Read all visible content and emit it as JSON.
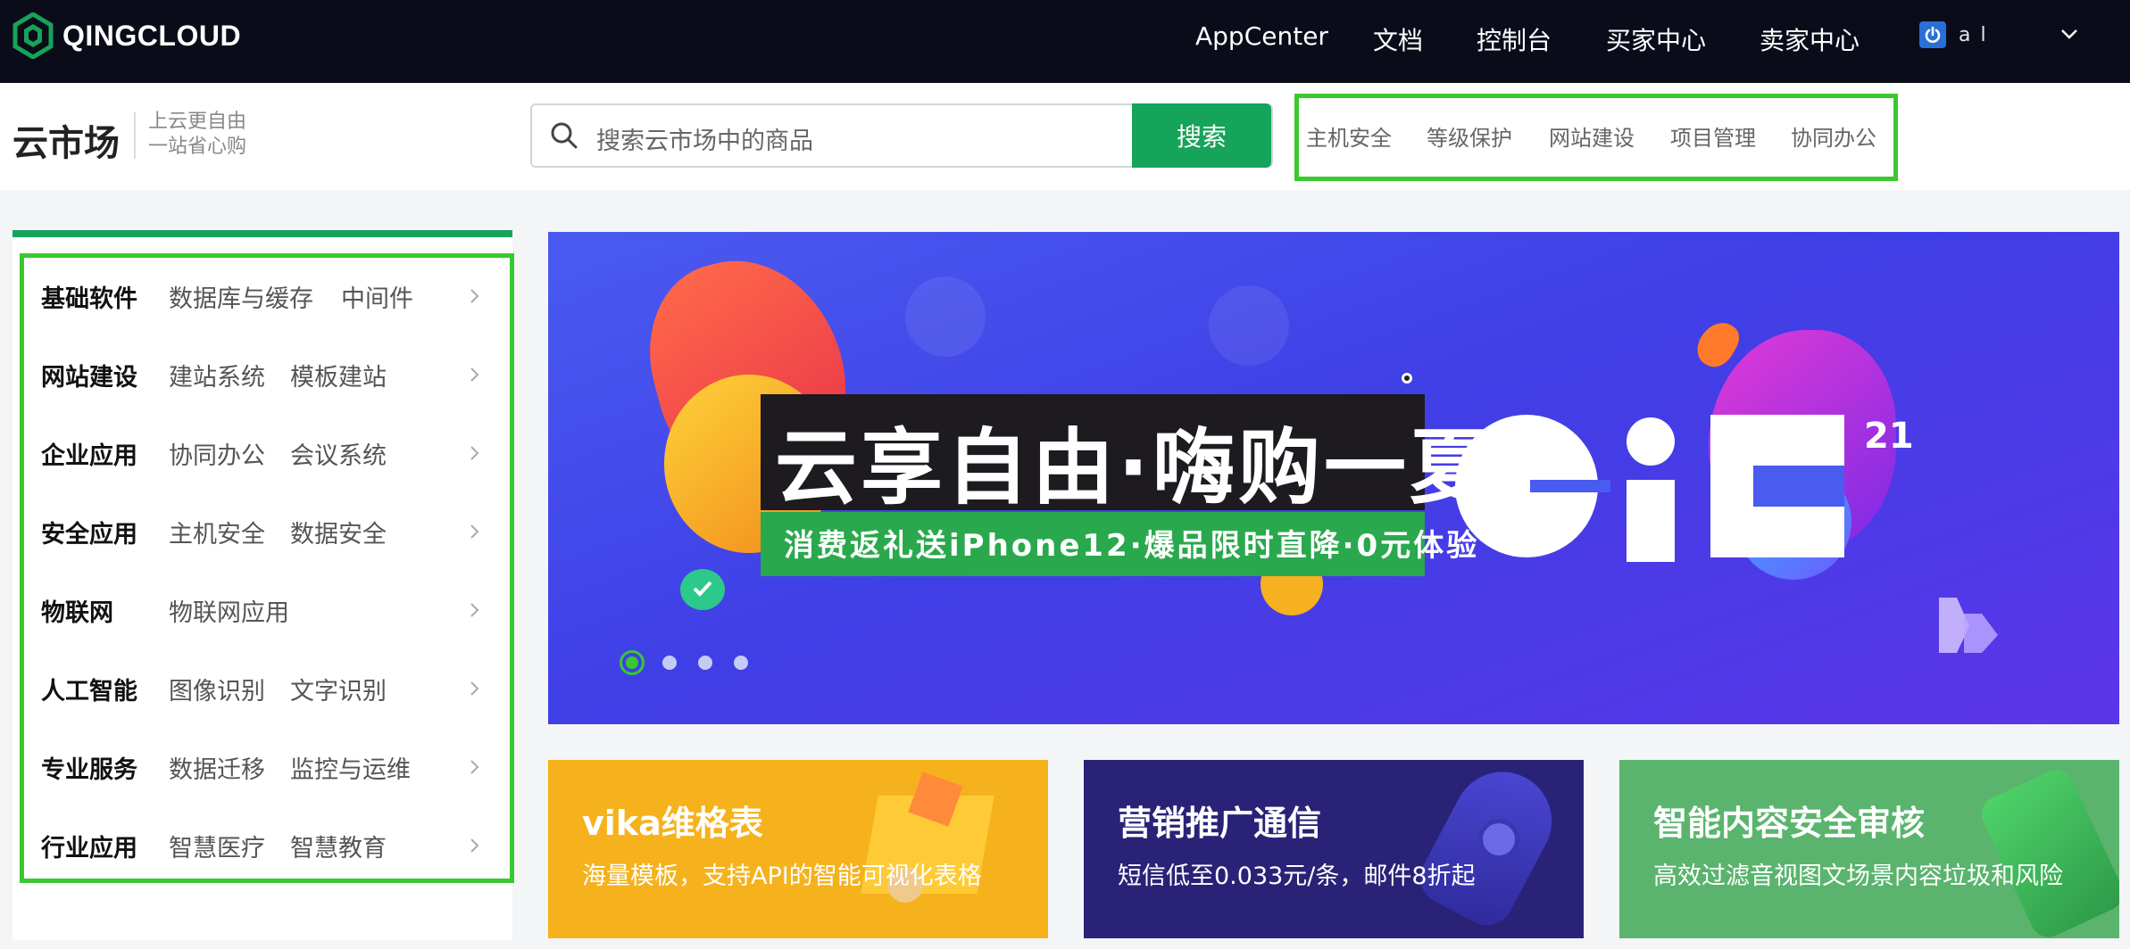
{
  "brand": {
    "name": "QINGCLOUD"
  },
  "topnav": {
    "items": [
      {
        "label": "AppCenter"
      },
      {
        "label": "文档"
      },
      {
        "label": "控制台"
      },
      {
        "label": "买家中心"
      },
      {
        "label": "卖家中心"
      }
    ],
    "user_name": "a   l"
  },
  "subheader": {
    "title": "云市场",
    "slogan_line1": "上云更自由",
    "slogan_line2": "一站省心购",
    "search_placeholder": "搜索云市场中的商品",
    "search_button": "搜索",
    "hot_tags": [
      "主机安全",
      "等级保护",
      "网站建设",
      "项目管理",
      "协同办公"
    ]
  },
  "categories": [
    {
      "main": "基础软件",
      "subs": [
        "数据库与缓存",
        "中间件"
      ]
    },
    {
      "main": "网站建设",
      "subs": [
        "建站系统",
        "模板建站"
      ]
    },
    {
      "main": "企业应用",
      "subs": [
        "协同办公",
        "会议系统"
      ]
    },
    {
      "main": "安全应用",
      "subs": [
        "主机安全",
        "数据安全"
      ]
    },
    {
      "main": "物联网",
      "subs": [
        "物联网应用"
      ]
    },
    {
      "main": "人工智能",
      "subs": [
        "图像识别",
        "文字识别"
      ]
    },
    {
      "main": "专业服务",
      "subs": [
        "数据迁移",
        "监控与运维"
      ]
    },
    {
      "main": "行业应用",
      "subs": [
        "智慧医疗",
        "智慧教育"
      ]
    }
  ],
  "banner": {
    "headline": "云享自由·嗨购一夏",
    "subline": "消费返礼送iPhone12·爆品限时直降·0元体验",
    "logo_text": "CiC",
    "logo_sup": "21",
    "carousel_active_index": 0,
    "carousel_count": 4
  },
  "promo_cards": [
    {
      "title": "vika维格表",
      "desc": "海量模板，支持API的智能可视化表格",
      "color": "#f5b21c"
    },
    {
      "title": "营销推广通信",
      "desc": "短信低至0.033元/条，邮件8折起",
      "color": "#2a2277"
    },
    {
      "title": "智能内容安全审核",
      "desc": "高效过滤音视图文场景内容垃圾和风险",
      "color": "#5ab46d"
    }
  ],
  "colors": {
    "accent": "#16a35a",
    "highlight_box": "#3ac82e",
    "topbar": "#0a0c19"
  }
}
